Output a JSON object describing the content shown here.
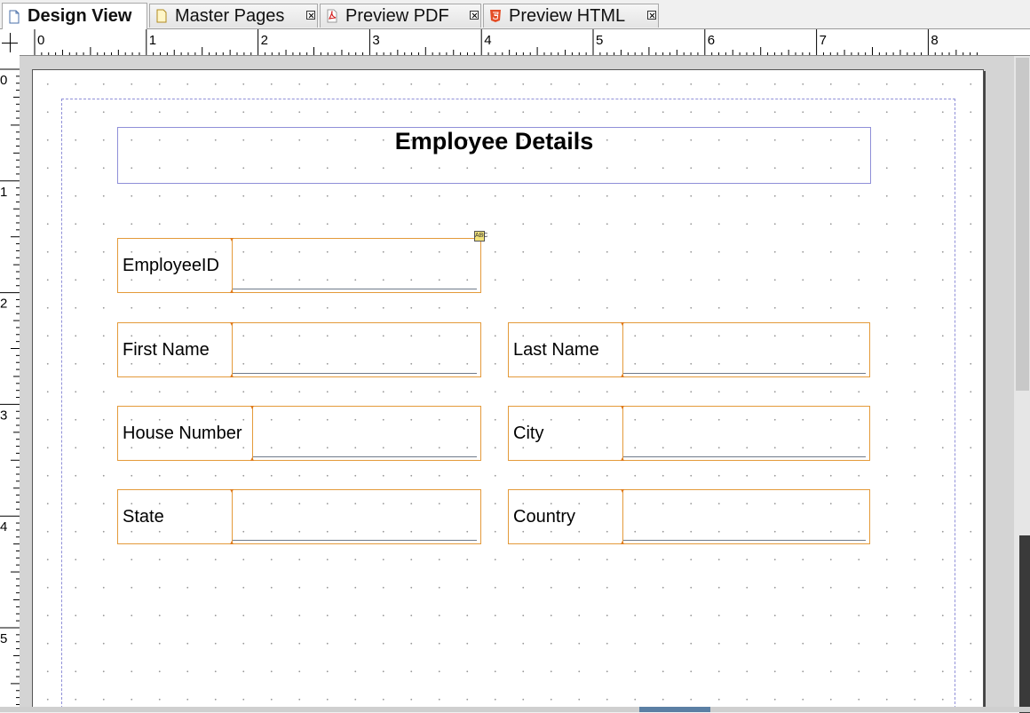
{
  "tabs": [
    {
      "label": "Design View",
      "icon": "page-icon",
      "active": true,
      "closable": false
    },
    {
      "label": "Master Pages",
      "icon": "master-page-icon",
      "active": false,
      "closable": true
    },
    {
      "label": "Preview PDF",
      "icon": "pdf-icon",
      "active": false,
      "closable": true
    },
    {
      "label": "Preview HTML",
      "icon": "html5-icon",
      "active": false,
      "closable": true
    }
  ],
  "ruler": {
    "horizontal_labels": [
      "0",
      "1",
      "2",
      "3",
      "4",
      "5",
      "6",
      "7",
      "8"
    ],
    "vertical_labels": [
      "0",
      "1",
      "2",
      "3",
      "4",
      "5"
    ]
  },
  "report": {
    "title": "Employee Details",
    "fields": [
      {
        "label": "EmployeeID",
        "value": ""
      },
      {
        "label": "First Name",
        "value": ""
      },
      {
        "label": "Last Name",
        "value": ""
      },
      {
        "label": "House Number",
        "value": ""
      },
      {
        "label": "City",
        "value": ""
      },
      {
        "label": "State",
        "value": ""
      },
      {
        "label": "Country",
        "value": ""
      }
    ]
  },
  "colors": {
    "field_border": "#e49a3a",
    "title_border": "#8f8fd8",
    "margin_guide": "#8f8fd8"
  }
}
